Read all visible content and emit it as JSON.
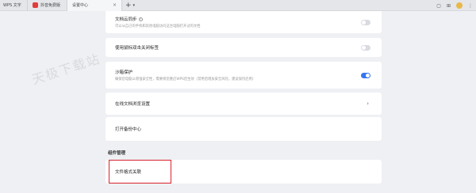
{
  "tabs": {
    "app_label": "WPS 文字",
    "doc_label": "抖音免费版",
    "active_label": "设置中心",
    "close_glyph": "×",
    "add_glyph": "+",
    "dropdown_glyph": "▾"
  },
  "watermark": "天极下载站",
  "settings": {
    "doc_sync": {
      "title": "文档云同步",
      "desc": "可以从自己的手机和其他电脑访问这台电脑打开过的文档",
      "enabled": false
    },
    "double_click_close": {
      "title": "使用鼠标双击关闭标签",
      "enabled": false
    },
    "sandbox": {
      "title": "沙箱保护",
      "desc": "确保您电脑以增强安全性，需要将您重启WPS后生效（禁用后增加安全风险，建议保持启用）",
      "enabled": true
    },
    "online_preview": {
      "title": "在线文档浏览设置",
      "chevron": "›"
    },
    "backup_center": {
      "title": "打开备份中心"
    }
  },
  "plugin_section": {
    "label": "组件管理",
    "file_assoc": {
      "title": "文件格式关联"
    }
  },
  "colors": {
    "accent": "#3575f0",
    "highlight": "#d9232d"
  }
}
